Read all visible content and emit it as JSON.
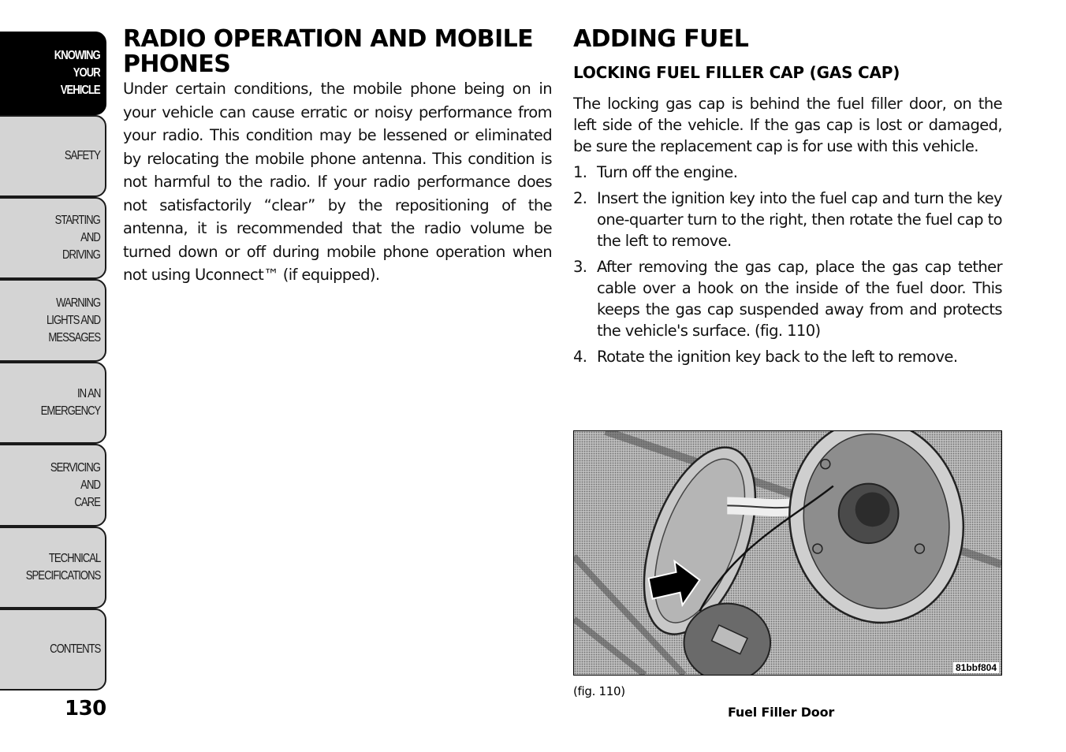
{
  "sidebar": {
    "tabs": [
      {
        "label": "KNOWING\nYOUR\nVEHICLE",
        "active": true
      },
      {
        "label": "SAFETY",
        "active": false
      },
      {
        "label": "STARTING\nAND\nDRIVING",
        "active": false
      },
      {
        "label": "WARNING\nLIGHTS AND\nMESSAGES",
        "active": false
      },
      {
        "label": "IN AN\nEMERGENCY",
        "active": false
      },
      {
        "label": "SERVICING\nAND\nCARE",
        "active": false
      },
      {
        "label": "TECHNICAL\nSPECIFICATIONS",
        "active": false
      },
      {
        "label": "CONTENTS",
        "active": false
      }
    ]
  },
  "page_number": "130",
  "left_section": {
    "title": "RADIO OPERATION AND MOBILE PHONES",
    "body": "Under certain conditions, the mobile phone being on in your vehicle can cause erratic or noisy performance from your radio. This condition may be lessened or eliminated by relocating the mobile phone antenna. This condition is not harmful to the radio. If your radio performance does not satisfactorily “clear” by the repositioning of the antenna, it is recommended that the radio volume be turned down or off during mobile phone operation when not using Uconnect™ (if equipped)."
  },
  "right_section": {
    "title": "ADDING FUEL",
    "subtitle": "LOCKING FUEL FILLER CAP (GAS CAP)",
    "intro": "The locking gas cap is behind the fuel filler door, on the left side of the vehicle. If the gas cap is lost or damaged, be sure the replacement cap is for use with this vehicle.",
    "steps": [
      {
        "num": "1.",
        "text": "Turn off the engine."
      },
      {
        "num": "2.",
        "text": "Insert the ignition key into the fuel cap and turn the key one-quarter turn to the right, then rotate the fuel cap to the left to remove."
      },
      {
        "num": "3.",
        "text": "After removing the gas cap, place the gas cap tether cable over a hook on the inside of the fuel door. This keeps the gas cap suspended away from and protects the vehicle's surface. (fig.  110)"
      },
      {
        "num": "4.",
        "text": "Rotate the ignition key back to the left to remove."
      }
    ]
  },
  "figure": {
    "code": "81bbf804",
    "reference": "(fig. 110)",
    "caption": "Fuel Filler Door"
  }
}
